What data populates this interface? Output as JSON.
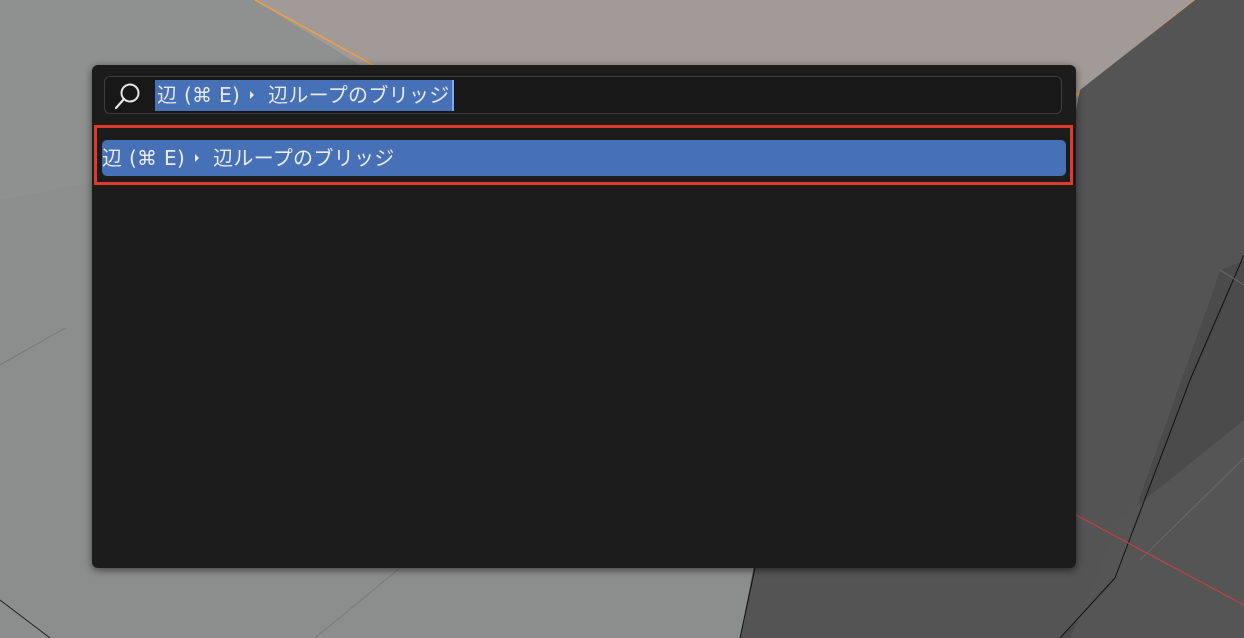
{
  "search": {
    "category": "辺 (⌘ E)",
    "item": "辺ループのブリッジ"
  },
  "result": {
    "category": "辺 (⌘ E)",
    "item": "辺ループのブリッジ"
  },
  "icons": {
    "search": "search-icon",
    "breadcrumb": "triangle-right-icon"
  },
  "colors": {
    "selection": "#4671b7",
    "highlight_box": "#e03a2a",
    "popup_bg": "#1c1c1c",
    "selected_face": "#a29a96",
    "active_edge": "#f0a040"
  }
}
